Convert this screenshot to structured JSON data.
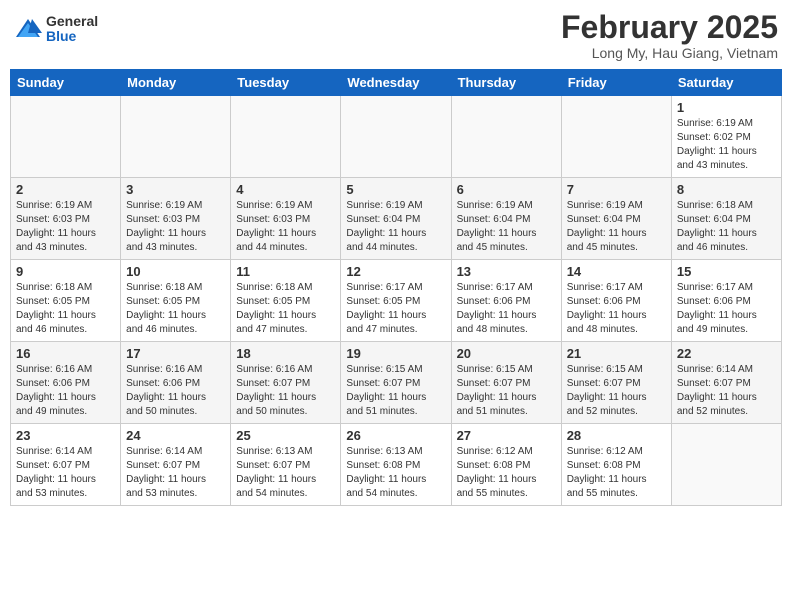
{
  "header": {
    "logo": {
      "general": "General",
      "blue": "Blue"
    },
    "title": "February 2025",
    "location": "Long My, Hau Giang, Vietnam"
  },
  "weekdays": [
    "Sunday",
    "Monday",
    "Tuesday",
    "Wednesday",
    "Thursday",
    "Friday",
    "Saturday"
  ],
  "weeks": [
    [
      {
        "day": "",
        "info": ""
      },
      {
        "day": "",
        "info": ""
      },
      {
        "day": "",
        "info": ""
      },
      {
        "day": "",
        "info": ""
      },
      {
        "day": "",
        "info": ""
      },
      {
        "day": "",
        "info": ""
      },
      {
        "day": "1",
        "info": "Sunrise: 6:19 AM\nSunset: 6:02 PM\nDaylight: 11 hours\nand 43 minutes."
      }
    ],
    [
      {
        "day": "2",
        "info": "Sunrise: 6:19 AM\nSunset: 6:03 PM\nDaylight: 11 hours\nand 43 minutes."
      },
      {
        "day": "3",
        "info": "Sunrise: 6:19 AM\nSunset: 6:03 PM\nDaylight: 11 hours\nand 43 minutes."
      },
      {
        "day": "4",
        "info": "Sunrise: 6:19 AM\nSunset: 6:03 PM\nDaylight: 11 hours\nand 44 minutes."
      },
      {
        "day": "5",
        "info": "Sunrise: 6:19 AM\nSunset: 6:04 PM\nDaylight: 11 hours\nand 44 minutes."
      },
      {
        "day": "6",
        "info": "Sunrise: 6:19 AM\nSunset: 6:04 PM\nDaylight: 11 hours\nand 45 minutes."
      },
      {
        "day": "7",
        "info": "Sunrise: 6:19 AM\nSunset: 6:04 PM\nDaylight: 11 hours\nand 45 minutes."
      },
      {
        "day": "8",
        "info": "Sunrise: 6:18 AM\nSunset: 6:04 PM\nDaylight: 11 hours\nand 46 minutes."
      }
    ],
    [
      {
        "day": "9",
        "info": "Sunrise: 6:18 AM\nSunset: 6:05 PM\nDaylight: 11 hours\nand 46 minutes."
      },
      {
        "day": "10",
        "info": "Sunrise: 6:18 AM\nSunset: 6:05 PM\nDaylight: 11 hours\nand 46 minutes."
      },
      {
        "day": "11",
        "info": "Sunrise: 6:18 AM\nSunset: 6:05 PM\nDaylight: 11 hours\nand 47 minutes."
      },
      {
        "day": "12",
        "info": "Sunrise: 6:17 AM\nSunset: 6:05 PM\nDaylight: 11 hours\nand 47 minutes."
      },
      {
        "day": "13",
        "info": "Sunrise: 6:17 AM\nSunset: 6:06 PM\nDaylight: 11 hours\nand 48 minutes."
      },
      {
        "day": "14",
        "info": "Sunrise: 6:17 AM\nSunset: 6:06 PM\nDaylight: 11 hours\nand 48 minutes."
      },
      {
        "day": "15",
        "info": "Sunrise: 6:17 AM\nSunset: 6:06 PM\nDaylight: 11 hours\nand 49 minutes."
      }
    ],
    [
      {
        "day": "16",
        "info": "Sunrise: 6:16 AM\nSunset: 6:06 PM\nDaylight: 11 hours\nand 49 minutes."
      },
      {
        "day": "17",
        "info": "Sunrise: 6:16 AM\nSunset: 6:06 PM\nDaylight: 11 hours\nand 50 minutes."
      },
      {
        "day": "18",
        "info": "Sunrise: 6:16 AM\nSunset: 6:07 PM\nDaylight: 11 hours\nand 50 minutes."
      },
      {
        "day": "19",
        "info": "Sunrise: 6:15 AM\nSunset: 6:07 PM\nDaylight: 11 hours\nand 51 minutes."
      },
      {
        "day": "20",
        "info": "Sunrise: 6:15 AM\nSunset: 6:07 PM\nDaylight: 11 hours\nand 51 minutes."
      },
      {
        "day": "21",
        "info": "Sunrise: 6:15 AM\nSunset: 6:07 PM\nDaylight: 11 hours\nand 52 minutes."
      },
      {
        "day": "22",
        "info": "Sunrise: 6:14 AM\nSunset: 6:07 PM\nDaylight: 11 hours\nand 52 minutes."
      }
    ],
    [
      {
        "day": "23",
        "info": "Sunrise: 6:14 AM\nSunset: 6:07 PM\nDaylight: 11 hours\nand 53 minutes."
      },
      {
        "day": "24",
        "info": "Sunrise: 6:14 AM\nSunset: 6:07 PM\nDaylight: 11 hours\nand 53 minutes."
      },
      {
        "day": "25",
        "info": "Sunrise: 6:13 AM\nSunset: 6:07 PM\nDaylight: 11 hours\nand 54 minutes."
      },
      {
        "day": "26",
        "info": "Sunrise: 6:13 AM\nSunset: 6:08 PM\nDaylight: 11 hours\nand 54 minutes."
      },
      {
        "day": "27",
        "info": "Sunrise: 6:12 AM\nSunset: 6:08 PM\nDaylight: 11 hours\nand 55 minutes."
      },
      {
        "day": "28",
        "info": "Sunrise: 6:12 AM\nSunset: 6:08 PM\nDaylight: 11 hours\nand 55 minutes."
      },
      {
        "day": "",
        "info": ""
      }
    ]
  ]
}
